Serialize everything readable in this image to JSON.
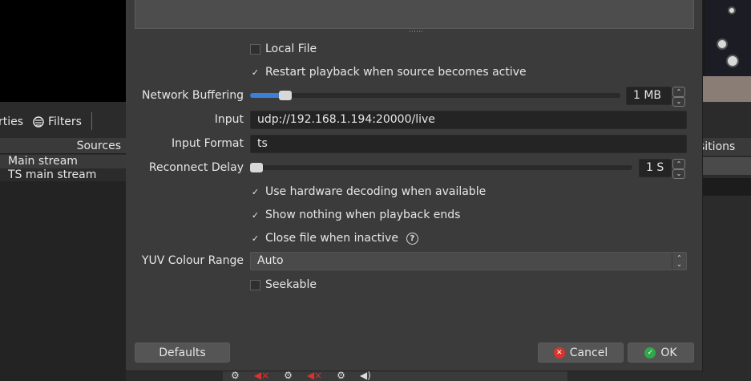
{
  "background": {
    "toolbar": {
      "properties_label": "rties",
      "filters_label": "Filters"
    },
    "sources_header": "Sources",
    "sources": [
      "Main stream",
      "TS main stream"
    ],
    "right_dock_header": "sitions"
  },
  "dialog": {
    "local_file": {
      "label": "Local File",
      "checked": false
    },
    "restart_playback": {
      "label": "Restart playback when source becomes active",
      "checked": true
    },
    "network_buffering": {
      "label": "Network Buffering",
      "value": "1 MB",
      "level": 0.08
    },
    "input": {
      "label": "Input",
      "value": "udp://192.168.1.194:20000/live"
    },
    "input_format": {
      "label": "Input Format",
      "value": "ts"
    },
    "reconnect_delay": {
      "label": "Reconnect Delay",
      "value": "1 S",
      "level": 0.0
    },
    "hw_decoding": {
      "label": "Use hardware decoding when available",
      "checked": true
    },
    "show_nothing": {
      "label": "Show nothing when playback ends",
      "checked": true
    },
    "close_file": {
      "label": "Close file when inactive",
      "checked": true
    },
    "yuv_range": {
      "label": "YUV Colour Range",
      "value": "Auto"
    },
    "seekable": {
      "label": "Seekable",
      "checked": false
    },
    "buttons": {
      "defaults": "Defaults",
      "cancel": "Cancel",
      "ok": "OK"
    }
  },
  "colors": {
    "accent": "#3d7fd6",
    "cancel_icon": "#d9342b",
    "ok_icon": "#2ea84a"
  }
}
